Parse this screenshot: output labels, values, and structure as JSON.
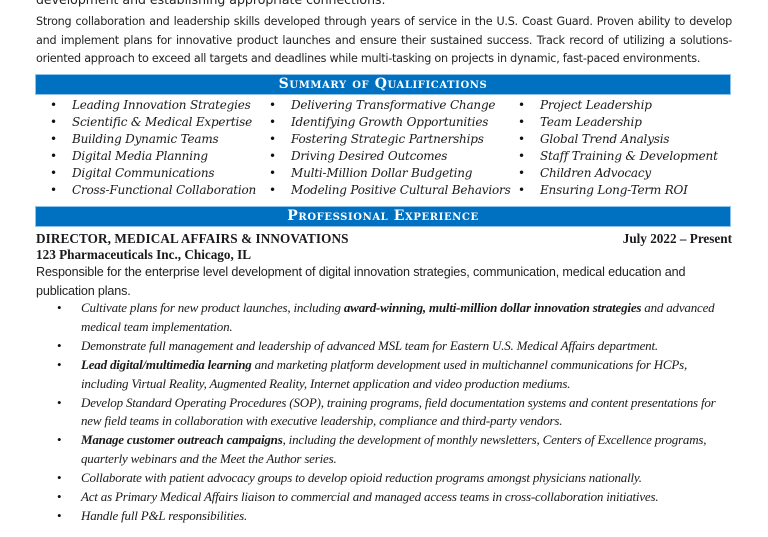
{
  "document": {
    "cut_line": "development and establishing appropriate connections.",
    "profile_paragraph": "Strong collaboration and leadership skills developed through years of service in the U.S. Coast Guard. Proven ability to develop and implement plans for innovative product launches and ensure their sustained success. Track record of utilizing a solutions-oriented approach to exceed all targets and deadlines while multi-tasking on projects in dynamic, fast-paced environments.",
    "bullet_glyph": "•",
    "colors": {
      "section_bar": "#0070c0",
      "section_bar_border": "#8fc3ea",
      "section_text": "#ffffff"
    }
  },
  "summary": {
    "heading": "Summary of Qualifications",
    "columns": [
      [
        "Leading Innovation Strategies",
        "Scientific & Medical Expertise",
        "Building Dynamic Teams",
        "Digital Media Planning",
        "Digital Communications",
        "Cross-Functional Collaboration"
      ],
      [
        "Delivering Transformative Change",
        "Identifying Growth Opportunities",
        "Fostering Strategic Partnerships",
        "Driving Desired Outcomes",
        "Multi-Million Dollar Budgeting",
        "Modeling Positive Cultural Behaviors"
      ],
      [
        "Project Leadership",
        "Team Leadership",
        "Global Trend Analysis",
        "Staff Training & Development",
        "Children Advocacy",
        "Ensuring Long-Term ROI"
      ]
    ]
  },
  "experience": {
    "heading": "Professional Experience",
    "jobs": [
      {
        "title": "DIRECTOR, MEDICAL AFFAIRS & INNOVATIONS",
        "dates": "July 2022 – Present",
        "company": "123 Pharmaceuticals Inc., Chicago, IL",
        "summary": "Responsible for the enterprise level development of digital innovation strategies, communication, medical education and publication plans.",
        "duties": [
          {
            "parts": [
              {
                "text": "Cultivate plans for new product launches, including ",
                "bold": false
              },
              {
                "text": "award-winning, multi-million dollar innovation strategies",
                "bold": true
              },
              {
                "text": " and advanced medical team implementation.",
                "bold": false
              }
            ]
          },
          {
            "parts": [
              {
                "text": "Demonstrate full management and leadership of advanced MSL team for Eastern U.S. Medical Affairs department.",
                "bold": false
              }
            ]
          },
          {
            "parts": [
              {
                "text": "Lead digital/multimedia learning",
                "bold": true
              },
              {
                "text": " and marketing platform development used in multichannel communications for HCPs, including Virtual Reality, Augmented Reality, Internet application and video production mediums.",
                "bold": false
              }
            ]
          },
          {
            "parts": [
              {
                "text": "Develop Standard Operating Procedures (SOP), training programs, field documentation systems and content presentations for new field teams in collaboration with executive leadership, compliance and third-party vendors.",
                "bold": false
              }
            ]
          },
          {
            "parts": [
              {
                "text": "Manage customer outreach campaigns",
                "bold": true
              },
              {
                "text": ", including the development of monthly newsletters, Centers of Excellence programs, quarterly webinars and the Meet the Author series.",
                "bold": false
              }
            ]
          },
          {
            "parts": [
              {
                "text": "Collaborate with patient advocacy groups to develop opioid reduction programs amongst physicians nationally.",
                "bold": false
              }
            ]
          },
          {
            "parts": [
              {
                "text": "Act as Primary Medical Affairs liaison to commercial and managed access teams in cross-collaboration initiatives.",
                "bold": false
              }
            ]
          },
          {
            "parts": [
              {
                "text": "Handle full P&L responsibilities.",
                "bold": false
              }
            ]
          }
        ]
      }
    ]
  }
}
